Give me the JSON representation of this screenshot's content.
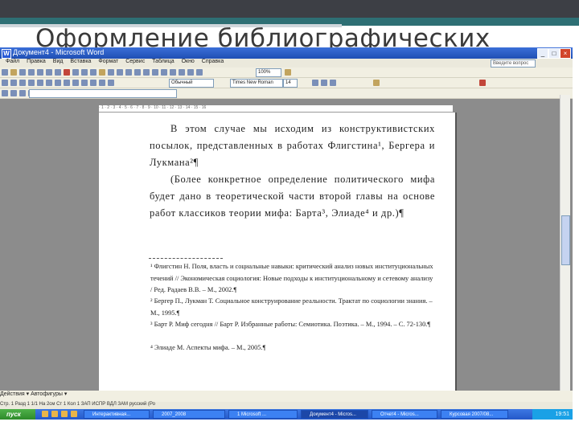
{
  "slide": {
    "title": "Оформление библиографических",
    "colors": {
      "top_bar": "#3d3f45",
      "accent": "#2e6f74"
    }
  },
  "window": {
    "title": "Документ4 - Microsoft Word",
    "icon": "word-icon",
    "controls": {
      "minimize": "_",
      "maximize": "□",
      "close": "×"
    }
  },
  "menu": {
    "items": [
      "Файл",
      "Правка",
      "Вид",
      "Вставка",
      "Формат",
      "Сервис",
      "Таблица",
      "Окно",
      "Справка"
    ],
    "help_box": "Введите вопрос"
  },
  "toolbar": {
    "zoom": "100%",
    "font_name": "Times New Roman",
    "font_size": "14",
    "style": "Обычный"
  },
  "document": {
    "paragraphs": [
      "В этом случае мы исходим из конструктивистских посылок, представленных в работах Флигстина¹, Бергера и Лукмана²¶",
      "(Более конкретное определение политического мифа будет дано в теоретической части второй главы на основе работ классиков теории мифа: Барта³, Элиаде⁴ и др.)¶"
    ],
    "footnotes": [
      "¹ Флигстин Н. Поля, власть и социальные навыки: критический анализ новых институциональных течений // Экономическая социология: Новые подходы к институциональному и сетевому анализу / Ред. Радаев В.В. – М., 2002.¶",
      "² Бергер П., Лукман Т. Социальное конструирование реальности. Трактат по социологии знания. – М., 1995.¶",
      "³ Барт Р. Миф сегодня // Барт Р. Избранные работы: Семиотика. Поэтика. – М., 1994. – С. 72-130.¶",
      "⁴ Элиаде М. Аспекты мифа. – М., 2005.¶"
    ]
  },
  "statusbar": {
    "text": "Стр. 1   Разд 1   1/1   На 2см   Ст 1   Кол 1   ЗАП  ИСПР  ВДЛ  ЗАМ   русский (Ро"
  },
  "drawbar": {
    "text": "Действия ▾   Автофигуры ▾"
  },
  "taskbar": {
    "start_label": "пуск",
    "tasks": [
      "Интерактивная...",
      "2007_2008",
      "1 Microsoft ...",
      "Документ4 - Micros...",
      "Отчет4 - Micros...",
      "Курсовая 2007/08..."
    ],
    "clock": "19:51"
  }
}
